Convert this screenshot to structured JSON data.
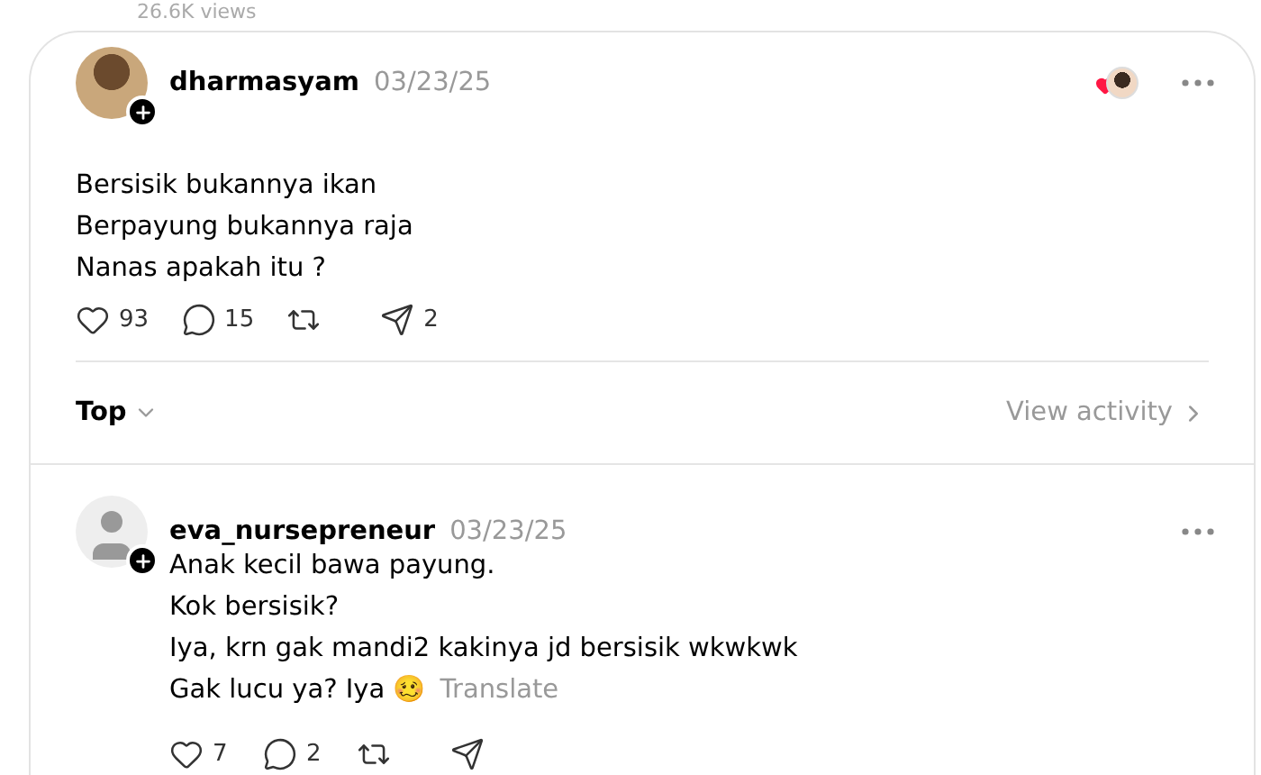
{
  "views_caption": "26.6K views",
  "post": {
    "author": "dharmasyam",
    "date": "03/23/25",
    "liked_by_author": true,
    "lines": [
      "Bersisik bukannya ikan",
      "Berpayung bukannya raja",
      "Nanas apakah itu ?"
    ],
    "actions": [
      {
        "kind": "like",
        "count": "93"
      },
      {
        "kind": "reply",
        "count": "15"
      },
      {
        "kind": "repost"
      },
      {
        "kind": "share",
        "count": "2"
      }
    ]
  },
  "sort": {
    "label": "Top",
    "activity_link": "View activity"
  },
  "replies": [
    {
      "author": "eva_nursepreneur",
      "date": "03/23/25",
      "lines": [
        "Anak kecil bawa payung.",
        "Kok bersisik?",
        "Iya, krn gak mandi2 kakinya jd bersisik wkwkwk",
        "Gak lucu ya? Iya 🥴"
      ],
      "translate": "Translate",
      "actions": [
        {
          "kind": "like",
          "count": "7"
        },
        {
          "kind": "reply",
          "count": "2"
        },
        {
          "kind": "repost"
        },
        {
          "kind": "share"
        }
      ]
    }
  ]
}
